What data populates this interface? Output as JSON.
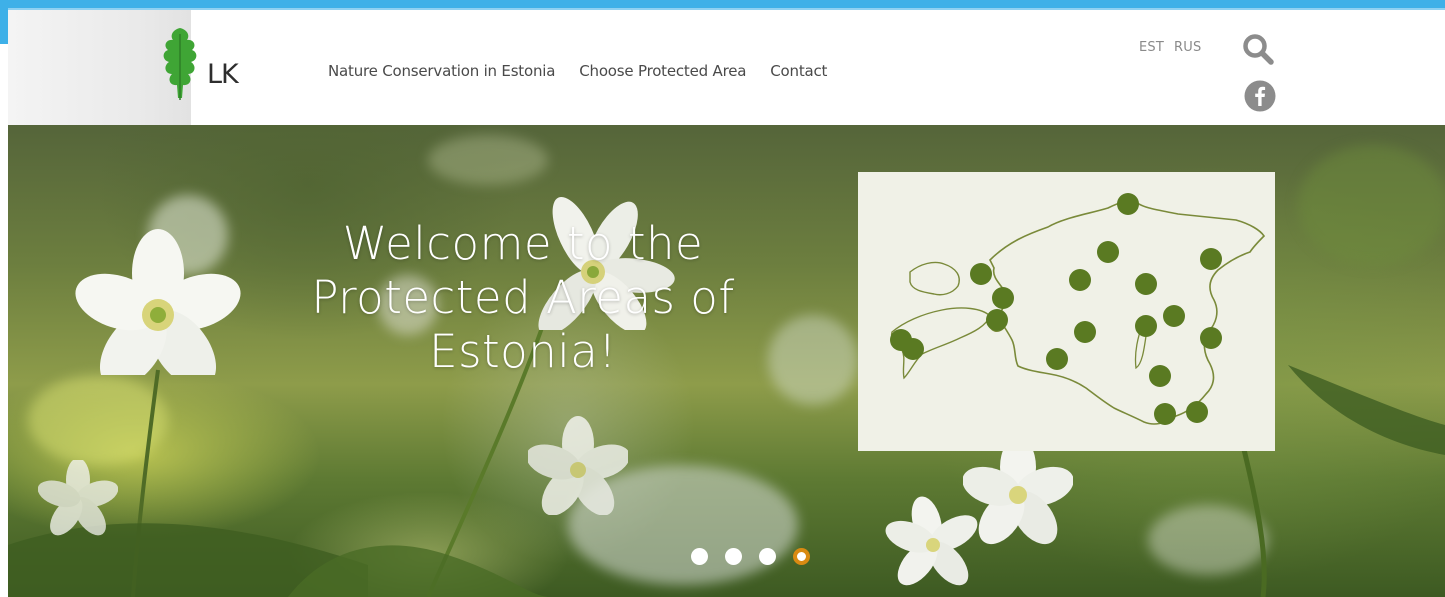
{
  "header": {
    "logo_text": "LK",
    "nav": [
      {
        "label": "Nature Conservation in Estonia"
      },
      {
        "label": "Choose Protected Area"
      },
      {
        "label": "Contact"
      }
    ],
    "languages": [
      "EST",
      "RUS"
    ],
    "icons": {
      "search": "search-icon",
      "facebook": "facebook-icon",
      "logo": "oak-leaf-logo"
    }
  },
  "hero": {
    "title_line1": "Welcome to the",
    "title_line2": "Protected Areas of",
    "title_line3": "Estonia!",
    "slider": {
      "total": 4,
      "active": 4
    }
  },
  "colors": {
    "brand_green": "#3fa535",
    "map_marker": "#5a7a22",
    "map_outline": "#7a8a3a",
    "active_dot": "#d98a12",
    "frame_blue": "#3eb0e8"
  }
}
